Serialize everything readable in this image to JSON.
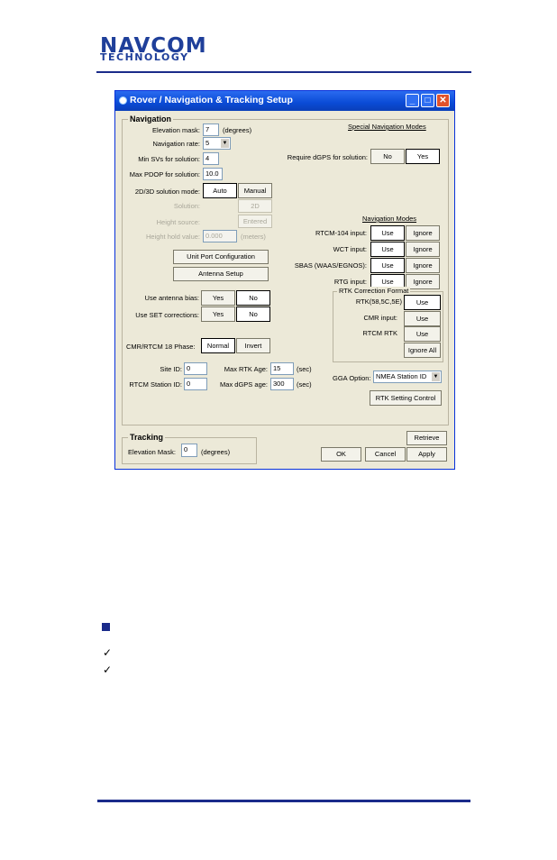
{
  "doc": {
    "logo_line1": "NAVCOM",
    "logo_line2": "TECHNOLOGY",
    "checks": [
      "✓",
      "✓"
    ]
  },
  "dialog": {
    "title": "Rover / Navigation & Tracking Setup",
    "window_buttons": {
      "minimize": "_",
      "maximize": "□",
      "close": "✕"
    },
    "navigation": {
      "group_title": "Navigation",
      "elevation_mask_label": "Elevation mask:",
      "elevation_mask_value": "7",
      "elevation_mask_unit": "(degrees)",
      "nav_rate_label": "Navigation rate:",
      "nav_rate_value": "5",
      "min_svs_label": "Min SVs for solution:",
      "min_svs_value": "4",
      "max_pdop_label": "Max PDOP for solution:",
      "max_pdop_value": "10.0",
      "mode_label": "2D/3D solution mode:",
      "mode_auto": "Auto",
      "mode_manual": "Manual",
      "solution_label": "Solution:",
      "solution_value": "2D",
      "height_source_label": "Height source:",
      "height_source_value": "Entered",
      "height_hold_label": "Height hold value:",
      "height_hold_value": "0.000",
      "height_hold_unit": "(meters)",
      "unit_port_button": "Unit Port Configuration",
      "antenna_setup_button": "Antenna Setup",
      "antenna_bias_label": "Use antenna bias:",
      "set_corrections_label": "Use SET corrections:",
      "yes": "Yes",
      "no": "No",
      "cmr_phase_label": "CMR/RTCM 18 Phase:",
      "cmr_normal": "Normal",
      "cmr_invert": "Invert",
      "site_id_label": "Site ID:",
      "site_id_value": "0",
      "rtcm_station_label": "RTCM Station ID:",
      "rtcm_station_value": "0",
      "max_rtk_age_label": "Max RTK Age:",
      "max_rtk_age_value": "15",
      "max_dgps_age_label": "Max dGPS age:",
      "max_dgps_age_value": "300",
      "sec": "(sec)"
    },
    "special": {
      "title": "Special Navigation Modes",
      "require_dgps_label": "Require dGPS for solution:",
      "no": "No",
      "yes": "Yes"
    },
    "nav_modes": {
      "title": "Navigation Modes",
      "rows": [
        {
          "label": "RTCM-104 input:",
          "use": "Use",
          "ignore": "Ignore"
        },
        {
          "label": "WCT input:",
          "use": "Use",
          "ignore": "Ignore"
        },
        {
          "label": "SBAS (WAAS/EGNOS):",
          "use": "Use",
          "ignore": "Ignore"
        },
        {
          "label": "RTG input:",
          "use": "Use",
          "ignore": "Ignore"
        }
      ]
    },
    "rtk_format": {
      "title": "RTK Correction Format",
      "rows": [
        {
          "label": "RTK(58,5C,5E)",
          "button": "Use"
        },
        {
          "label": "CMR input:",
          "button": "Use"
        },
        {
          "label": "RTCM RTK",
          "button": "Use"
        }
      ],
      "ignore_all": "Ignore All"
    },
    "gga_label": "GGA Option:",
    "gga_value": "NMEA Station ID",
    "rtk_setting_button": "RTK Setting Control",
    "tracking": {
      "group_title": "Tracking",
      "elev_label": "Elevation Mask:",
      "elev_value": "0",
      "elev_unit": "(degrees)"
    },
    "retrieve_button": "Retrieve",
    "ok_button": "OK",
    "cancel_button": "Cancel",
    "apply_button": "Apply"
  }
}
